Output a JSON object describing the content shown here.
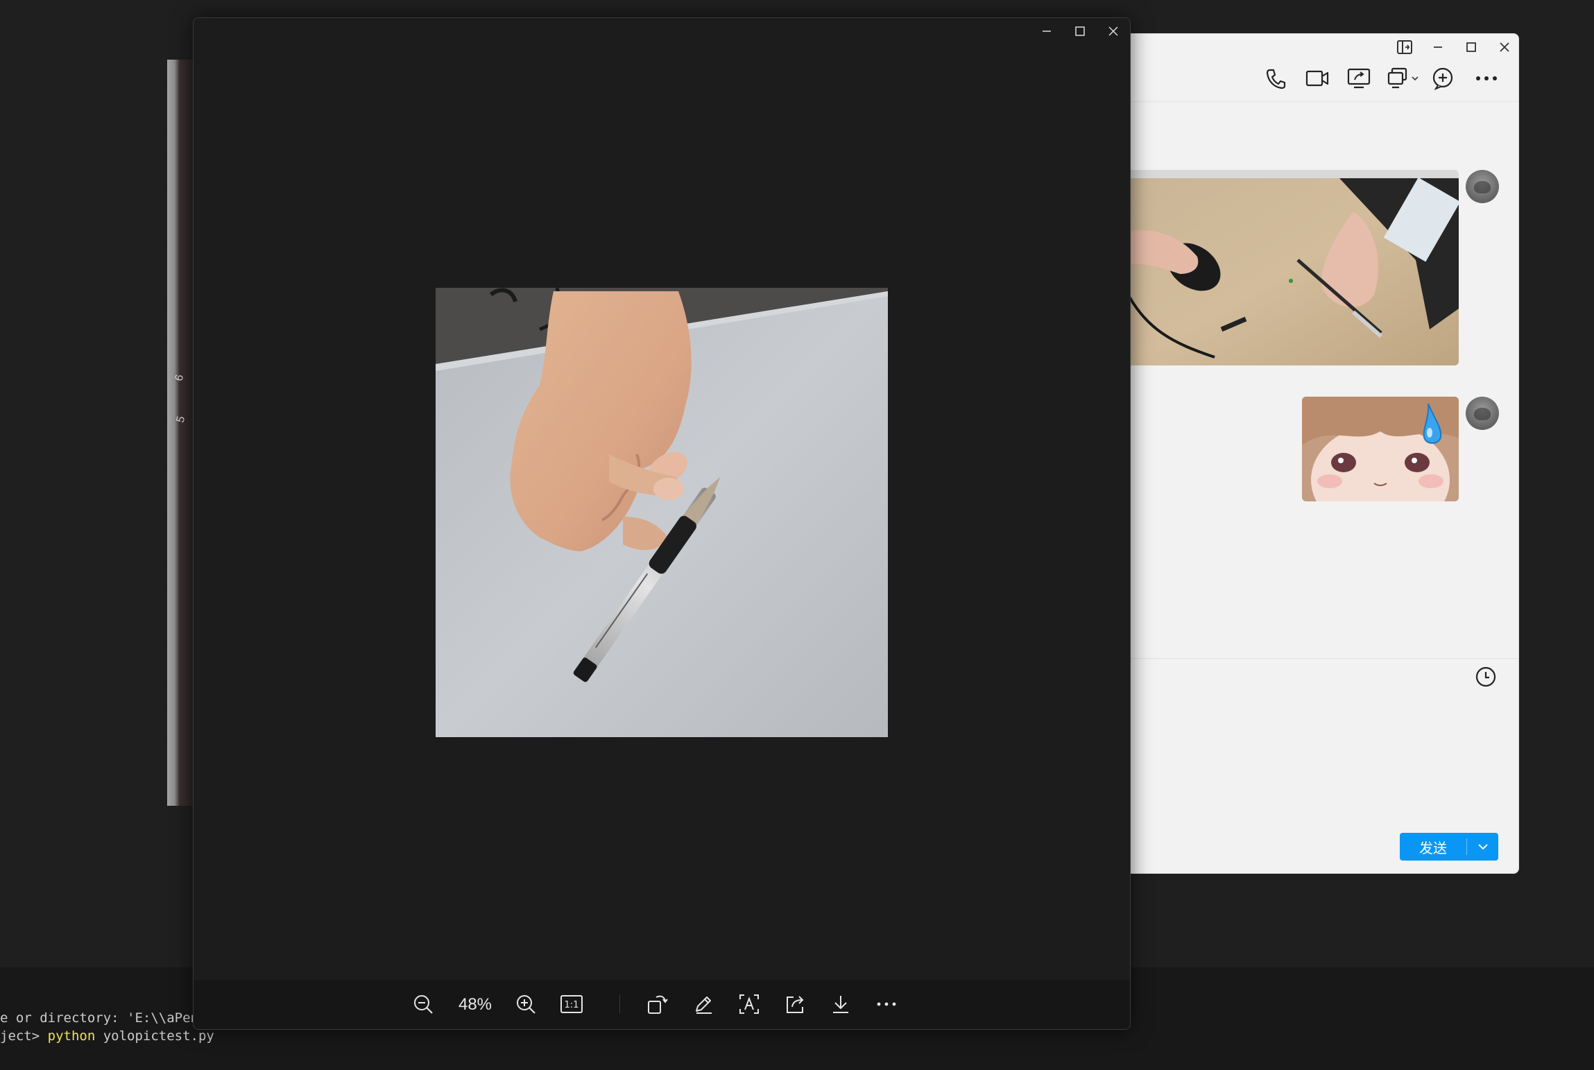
{
  "terminal": {
    "line1": "e or directory: 'E:\\\\aPen",
    "line2_prompt": "ject> ",
    "line2_cmd": "python",
    "line2_arg": " yolopictest.py"
  },
  "viewer": {
    "zoom_level": "48%",
    "window_controls": [
      "minimize-icon",
      "maximize-icon",
      "close-icon"
    ],
    "toolbar_icons": [
      "zoom-out-icon",
      "zoom-in-icon",
      "actual-size-icon",
      "rotate-icon",
      "edit-icon",
      "text-recognition-icon",
      "share-icon",
      "download-icon",
      "more-icon"
    ],
    "actual_size_label": "1:1"
  },
  "chat": {
    "header_icons": [
      "phone-icon",
      "video-icon",
      "screen-share-icon",
      "remote-assist-icon",
      "add-icon",
      "more-icon"
    ],
    "history_icon": "clock-icon",
    "send_label": "发送",
    "colors": {
      "send_button": "#0a96f5"
    }
  },
  "background_photo": {
    "keys": [
      "6",
      "5"
    ]
  }
}
